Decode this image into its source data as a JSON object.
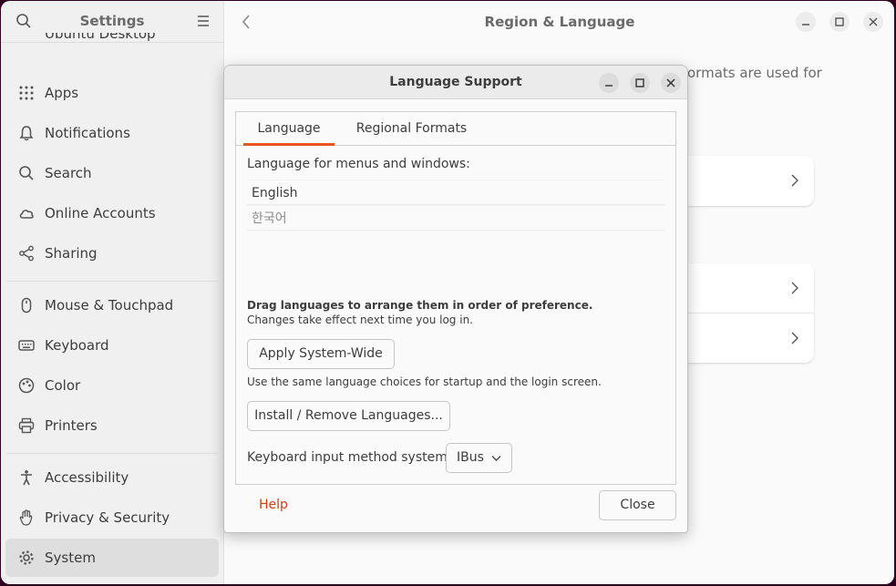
{
  "sidebar": {
    "title": "Settings",
    "partial_item": "Ubuntu Desktop",
    "items": [
      {
        "label": "Apps",
        "icon": "apps-grid-icon"
      },
      {
        "label": "Notifications",
        "icon": "bell-icon"
      },
      {
        "label": "Search",
        "icon": "search-icon"
      },
      {
        "label": "Online Accounts",
        "icon": "cloud-icon"
      },
      {
        "label": "Sharing",
        "icon": "share-icon"
      },
      {
        "label": "Mouse & Touchpad",
        "icon": "mouse-icon"
      },
      {
        "label": "Keyboard",
        "icon": "keyboard-icon"
      },
      {
        "label": "Color",
        "icon": "color-icon"
      },
      {
        "label": "Printers",
        "icon": "printer-icon"
      },
      {
        "label": "Accessibility",
        "icon": "accessibility-icon"
      },
      {
        "label": "Privacy & Security",
        "icon": "hand-icon"
      },
      {
        "label": "System",
        "icon": "gear-icon"
      }
    ]
  },
  "main": {
    "title": "Region & Language",
    "partial_text": "ormats are used for"
  },
  "dialog": {
    "title": "Language Support",
    "tabs": [
      "Language",
      "Regional Formats"
    ],
    "language_label": "Language for menus and windows:",
    "languages": [
      "English",
      "한국어"
    ],
    "drag_hint": "Drag languages to arrange them in order of preference.",
    "changes_hint": "Changes take effect next time you log in.",
    "apply_button": "Apply System-Wide",
    "apply_hint": "Use the same language choices for startup and the login screen.",
    "install_button": "Install / Remove Languages...",
    "input_label": "Keyboard input method system:",
    "input_value": "IBus",
    "help_label": "Help",
    "close_label": "Close"
  },
  "colors": {
    "accent": "#e95420",
    "help_link": "#c7421a"
  }
}
